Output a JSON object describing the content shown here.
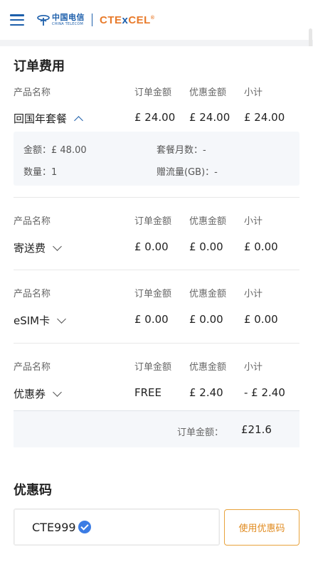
{
  "header": {
    "logo_cn": "中国电信",
    "logo_en": "CHINA TELECOM",
    "logo_tex_a": "CTE",
    "logo_tex_b": "x",
    "logo_tex_c": "CEL",
    "logo_tm": "®"
  },
  "order": {
    "title": "订单费用",
    "col_product": "产品名称",
    "col_order_amount": "订单金额",
    "col_discount": "优惠金额",
    "col_subtotal": "小计",
    "items": [
      {
        "name": "回国年套餐",
        "order_amount": "£ 24.00",
        "discount": "£ 24.00",
        "subtotal": "£ 24.00",
        "expanded": true,
        "details": {
          "amount": "金额：£ 48.00",
          "months": "套餐月数：-",
          "quantity": "数量：1",
          "bonus_data": "赠流量(GB)：-"
        }
      },
      {
        "name": "寄送费",
        "order_amount": "£ 0.00",
        "discount": "£ 0.00",
        "subtotal": "£ 0.00"
      },
      {
        "name": "eSIM卡",
        "order_amount": "£ 0.00",
        "discount": "£ 0.00",
        "subtotal": "£ 0.00"
      },
      {
        "name": "优惠券",
        "order_amount": "FREE",
        "discount": "£ 2.40",
        "subtotal": "- £ 2.40"
      }
    ],
    "total_label": "订单金额：",
    "total_value": "£21.6"
  },
  "coupon": {
    "title": "优惠码",
    "code": "CTE999",
    "apply_label": "使用优惠码"
  },
  "colors": {
    "brand_blue": "#1d5fab",
    "accent_orange": "#e08a1e",
    "verified_blue": "#3b7ce4"
  }
}
